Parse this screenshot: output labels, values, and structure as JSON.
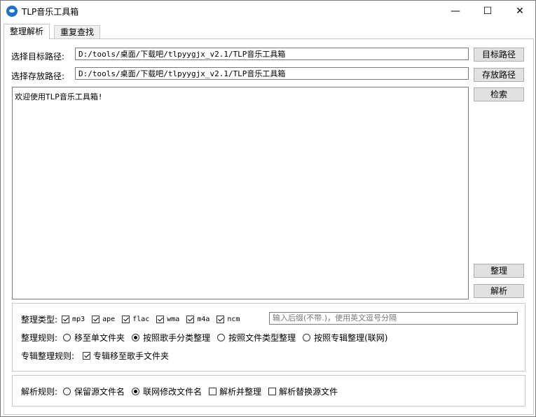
{
  "window": {
    "title": "TLP音乐工具箱",
    "minimize": "—",
    "maximize": "☐",
    "close": "✕",
    "app_icon": "music-app-icon"
  },
  "tabs": [
    {
      "label": "整理解析",
      "active": true
    },
    {
      "label": "重复查找",
      "active": false
    }
  ],
  "paths": {
    "target_label": "选择目标路径:",
    "target_value": "D:/tools/桌面/下载吧/tlpyygjx_v2.1/TLP音乐工具箱",
    "target_button": "目标路径",
    "save_label": "选择存放路径:",
    "save_value": "D:/tools/桌面/下载吧/tlpyygjx_v2.1/TLP音乐工具箱",
    "save_button": "存放路径"
  },
  "log": {
    "text": "欢迎使用TLP音乐工具箱!"
  },
  "side_buttons": {
    "search": "检索",
    "organize": "整理",
    "parse": "解析"
  },
  "organize": {
    "type_label": "整理类型:",
    "types": [
      {
        "label": "mp3",
        "checked": true
      },
      {
        "label": "ape",
        "checked": true
      },
      {
        "label": "flac",
        "checked": true
      },
      {
        "label": "wma",
        "checked": true
      },
      {
        "label": "m4a",
        "checked": true
      },
      {
        "label": "ncm",
        "checked": true
      }
    ],
    "suffix_placeholder": "输入后缀(不带.)，使用英文逗号分隔",
    "rule_label": "整理规则:",
    "rules": [
      {
        "label": "移至单文件夹",
        "selected": false
      },
      {
        "label": "按照歌手分类整理",
        "selected": true
      },
      {
        "label": "按照文件类型整理",
        "selected": false
      },
      {
        "label": "按照专辑整理(联网)",
        "selected": false
      }
    ],
    "album_rule_label": "专辑整理规则:",
    "album_option": {
      "label": "专辑移至歌手文件夹",
      "checked": true
    }
  },
  "parse": {
    "rule_label": "解析规则:",
    "radios": [
      {
        "label": "保留源文件名",
        "selected": false
      },
      {
        "label": "联网修改文件名",
        "selected": true
      }
    ],
    "checks": [
      {
        "label": "解析并整理",
        "checked": false
      },
      {
        "label": "解析替换源文件",
        "checked": false
      }
    ]
  }
}
